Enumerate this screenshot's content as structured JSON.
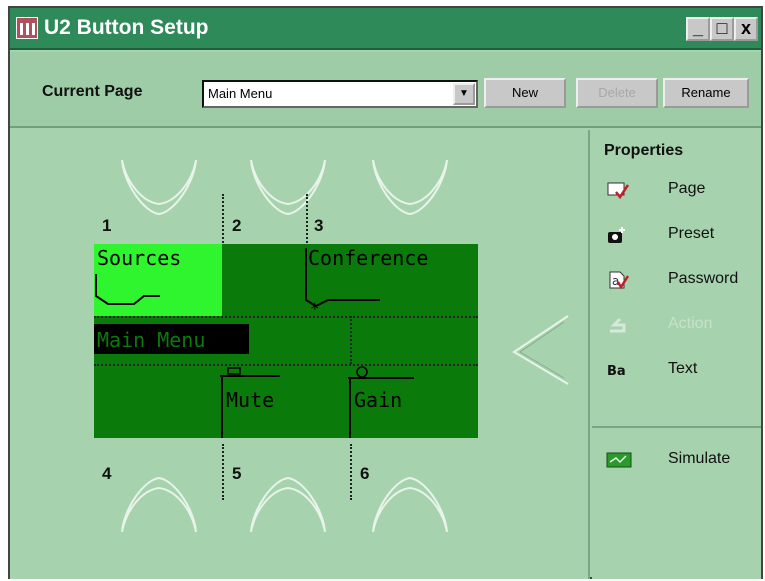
{
  "window": {
    "title": "U2 Button Setup"
  },
  "title_buttons": {
    "minimize": "_",
    "maximize": "□",
    "close": "x"
  },
  "toolbar": {
    "current_page_label": "Current Page",
    "current_page_value": "Main Menu",
    "new_label": "New",
    "delete_label": "Delete",
    "rename_label": "Rename"
  },
  "properties": {
    "heading": "Properties",
    "items": [
      {
        "label": "Page",
        "icon": "page-icon",
        "enabled": true
      },
      {
        "label": "Preset",
        "icon": "preset-icon",
        "enabled": true
      },
      {
        "label": "Password",
        "icon": "password-icon",
        "enabled": true
      },
      {
        "label": "Action",
        "icon": "action-icon",
        "enabled": false
      },
      {
        "label": "Text",
        "icon": "text-icon",
        "enabled": true
      }
    ],
    "simulate_label": "Simulate"
  },
  "screen": {
    "cells": {
      "sources": "Sources",
      "conference": "Conference",
      "main_menu": "Main Menu",
      "mute": "Mute",
      "gain": "Gain"
    }
  },
  "button_numbers": [
    "1",
    "2",
    "3",
    "4",
    "5",
    "6"
  ],
  "colors": {
    "title_bar": "#2f8a5a",
    "background": "#a6d2ad",
    "screen_green": "#0a7a0a",
    "highlight_green": "#2ef52e"
  }
}
